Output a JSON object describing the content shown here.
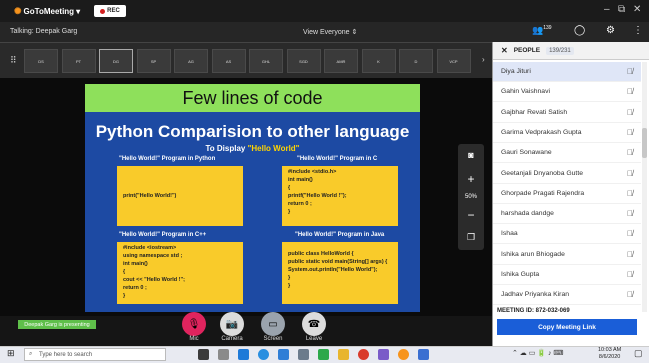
{
  "app": {
    "name": "GoToMeeting",
    "rec_label": "REC"
  },
  "bar2": {
    "talking": "Talking: Deepak Garg",
    "view": "View Everyone",
    "people_count": "139"
  },
  "thumbs": [
    "DS",
    "PT",
    "DG",
    "SP",
    "AG",
    "AS",
    "GHL",
    "SGD",
    "AMR",
    "K",
    "D",
    "VCP"
  ],
  "slide": {
    "heading": "Few lines of code",
    "title": "Python Comparision to other language",
    "sub_prefix": "To Display ",
    "sub_highlight": "\"Hello World\"",
    "boxes": [
      {
        "label": "\"Hello World!\" Program in Python",
        "code": [
          "print(\"Hello World!\")"
        ]
      },
      {
        "label": "\"Hello World!\" Program in C",
        "code": [
          "#include <stdio.h>",
          "int main()",
          "{",
          "printf(\"Hello World !\");",
          "return 0 ;",
          "}"
        ]
      },
      {
        "label": "\"Hello World!\" Program in C++",
        "code": [
          "#include <iostream>",
          "using namespace std ;",
          "int main()",
          "{",
          "cout << \"Hello World !\";",
          "return 0 ;",
          "}"
        ]
      },
      {
        "label": "\"Hello World!\" Program in Java",
        "code": [
          "public class HelloWorld {",
          "public static void main(String[] args) {",
          "System.out.println(\"Hello World\");",
          "}",
          "}"
        ]
      }
    ]
  },
  "presenting": "Deepak Garg is presenting",
  "controls": [
    {
      "label": "Mic",
      "icon": "mic-muted-icon",
      "color": "#e0245e"
    },
    {
      "label": "Camera",
      "icon": "camera-icon",
      "color": "#dcdcdc"
    },
    {
      "label": "Screen",
      "icon": "screen-icon",
      "color": "#9aa3ad"
    },
    {
      "label": "Leave",
      "icon": "phone-icon",
      "color": "#dcdcdc"
    }
  ],
  "sidetools": {
    "zoom": "50%"
  },
  "panel": {
    "title": "PEOPLE",
    "count": "139/231",
    "people": [
      "Diya Jituri",
      "Gahin Vaishnavi",
      "Gajbhar Revati Satish",
      "Garima Vedprakash Gupta",
      "Gauri Sonawane",
      "Geetanjali Dnyanoba Gutte",
      "Ghorpade Pragati Rajendra",
      "harshada dandge",
      "Ishaa",
      "Ishika arun Bhiogade",
      "Ishika Gupta",
      "Jadhav Priyanka Kiran"
    ],
    "meeting_id": "MEETING ID:  872-032-069",
    "copy_link": "Copy Meeting Link"
  },
  "taskbar": {
    "search": "Type here to search",
    "time": "10:03 AM",
    "date": "8/6/2020"
  }
}
